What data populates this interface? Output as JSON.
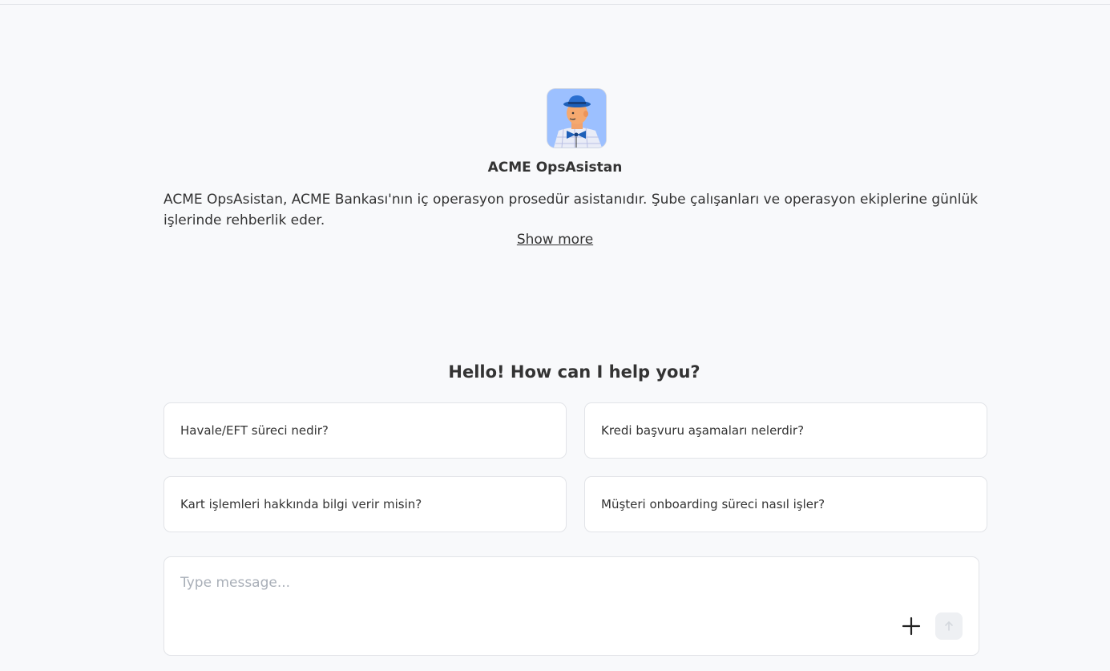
{
  "assistant": {
    "name": "ACME OpsAsistan",
    "description": "ACME OpsAsistan, ACME Bankası'nın iç operasyon prosedür asistanıdır. Şube çalışanları ve operasyon ekiplerine günlük işlerinde rehberlik eder.",
    "show_more_label": "Show more"
  },
  "greeting": "Hello! How can I help you?",
  "suggestions": [
    {
      "label": "Havale/EFT süreci nedir?"
    },
    {
      "label": "Kredi başvuru aşamaları nelerdir?"
    },
    {
      "label": "Kart işlemleri hakkında bilgi verir misin?"
    },
    {
      "label": "Müşteri onboarding süreci nasıl işler?"
    }
  ],
  "composer": {
    "placeholder": "Type message...",
    "value": ""
  },
  "icons": {
    "avatar": "assistant-avatar",
    "attach": "plus-icon",
    "send": "arrow-up-icon"
  },
  "colors": {
    "background": "#f8f9fb",
    "card_border": "#e2e4e8",
    "text": "#333333",
    "placeholder": "#a9afb8",
    "send_disabled_bg": "#eef0f3"
  }
}
